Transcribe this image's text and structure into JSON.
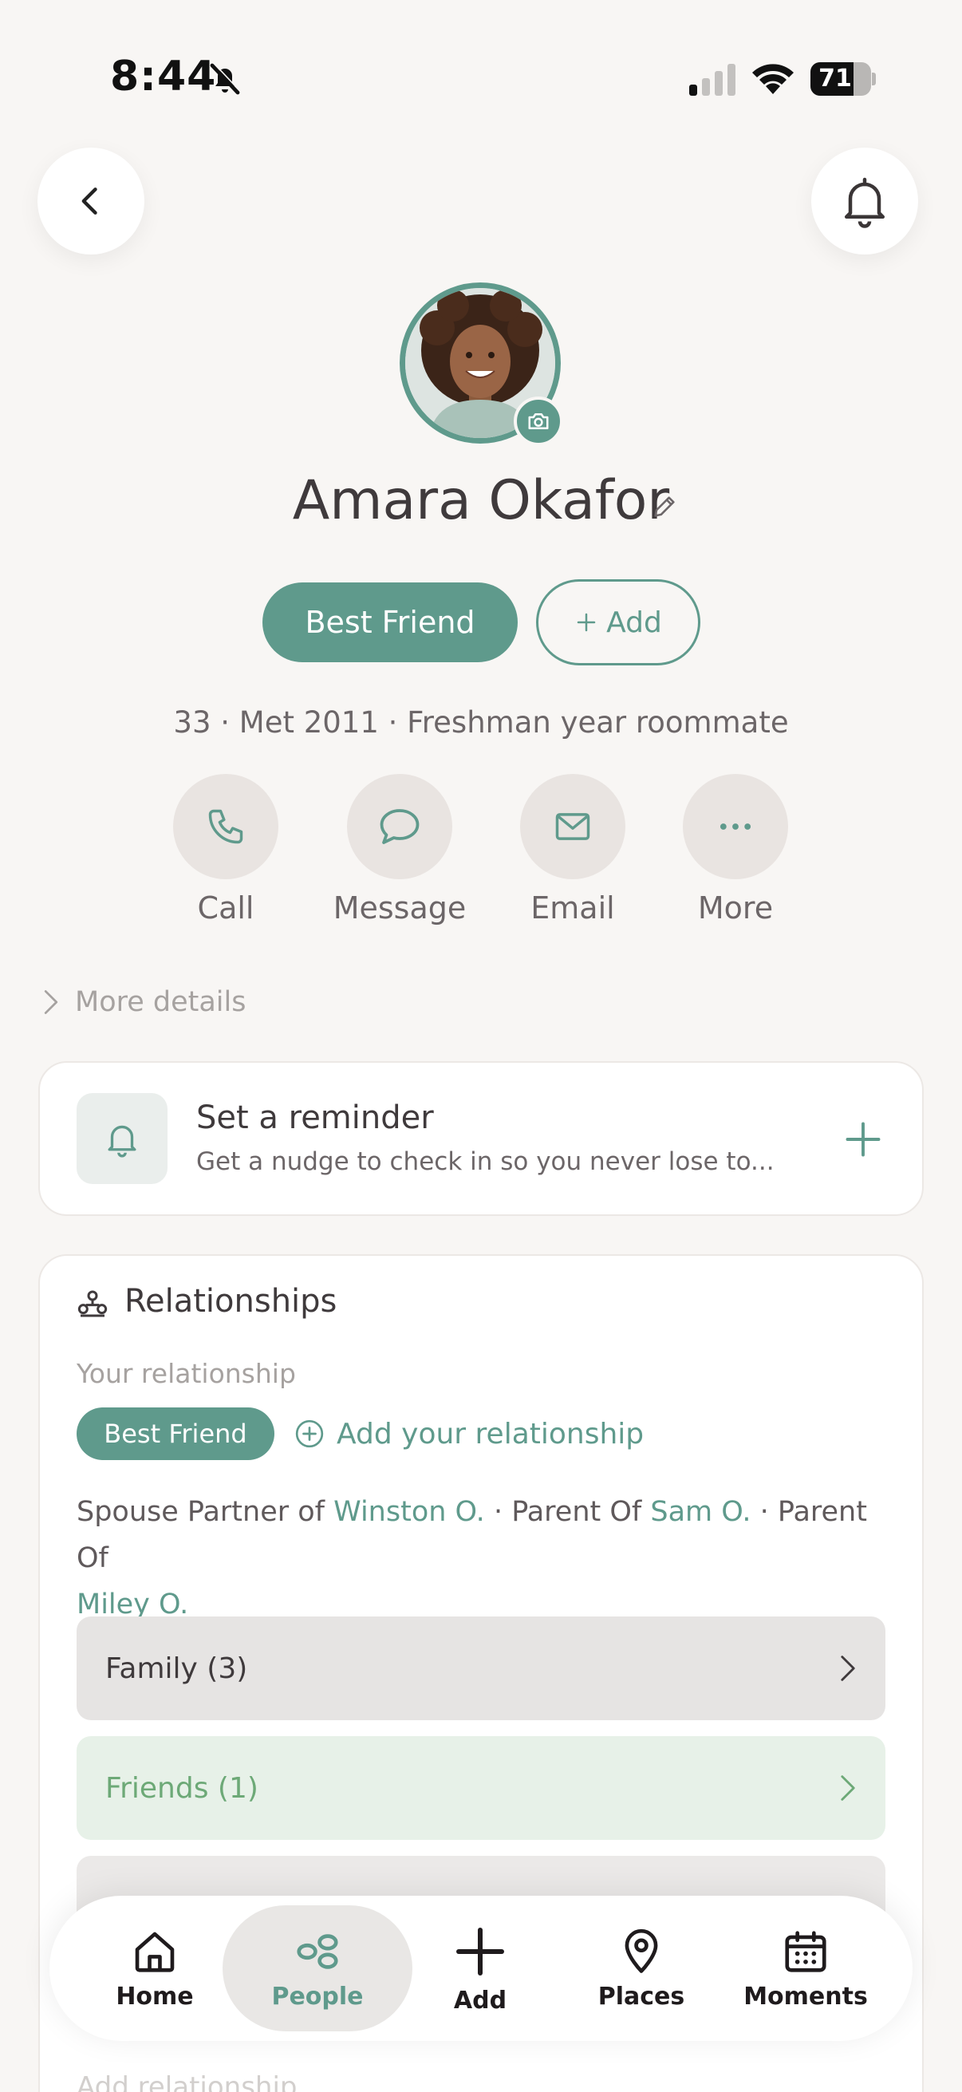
{
  "status_bar": {
    "time": "8:44",
    "battery": "71",
    "battery_level": 0.71
  },
  "profile": {
    "name": "Amara Okafor",
    "tag": "Best Friend",
    "add_label": "Add",
    "meta": "33 · Met 2011 · Freshman year roommate"
  },
  "actions": [
    {
      "label": "Call",
      "icon": "phone-icon"
    },
    {
      "label": "Message",
      "icon": "chat-bubble-icon"
    },
    {
      "label": "Email",
      "icon": "envelope-icon"
    },
    {
      "label": "More",
      "icon": "ellipsis-icon"
    }
  ],
  "more_details": "More details",
  "reminder": {
    "title": "Set a reminder",
    "subtitle": "Get a nudge to check in so you never lose to..."
  },
  "relationships": {
    "title": "Relationships",
    "your_relationship_label": "Your relationship",
    "chip": "Best Friend",
    "add_label": "Add your relationship",
    "line": {
      "p1": "Spouse Partner of",
      "l1": "Winston O.",
      "p2": "· Parent Of",
      "l2": "Sam O.",
      "p3": "· Parent Of",
      "l3": "Miley O."
    },
    "rows": [
      {
        "label": "Family (3)"
      },
      {
        "label": "Friends (1)"
      }
    ],
    "ghost": "Add relationship"
  },
  "nav": [
    {
      "label": "Home",
      "icon": "home-icon"
    },
    {
      "label": "People",
      "icon": "people-icon"
    },
    {
      "label": "Add",
      "icon": "plus-icon"
    },
    {
      "label": "Places",
      "icon": "map-pin-icon"
    },
    {
      "label": "Moments",
      "icon": "calendar-icon"
    }
  ],
  "colors": {
    "accent": "#5f9a8c",
    "background": "#f8f6f4",
    "friends_green": "#6da977"
  }
}
